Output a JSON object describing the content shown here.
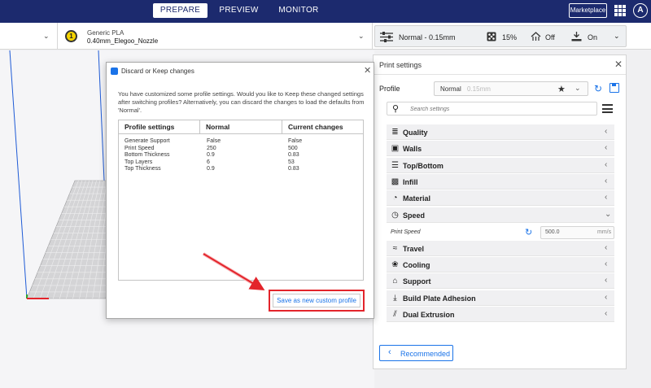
{
  "nav": {
    "tabs": [
      {
        "label": "PREPARE",
        "active": true
      },
      {
        "label": "PREVIEW",
        "active": false
      },
      {
        "label": "MONITOR",
        "active": false
      }
    ],
    "marketplace_label": "Marketplace",
    "avatar_initial": "A"
  },
  "toolbar": {
    "extruder_number": "1",
    "material": "Generic PLA",
    "nozzle": "0.40mm_Elegoo_Nozzle",
    "print_profile": "Normal - 0.15mm",
    "infill": "15%",
    "support": "Off",
    "adhesion": "On"
  },
  "panel": {
    "title": "Print settings",
    "profile_label": "Profile",
    "profile_name": "Normal",
    "profile_sub": "0.15mm",
    "search_placeholder": "Search settings",
    "categories": [
      {
        "label": "Quality",
        "icon": "quality-icon",
        "expanded": false
      },
      {
        "label": "Walls",
        "icon": "walls-icon",
        "expanded": false
      },
      {
        "label": "Top/Bottom",
        "icon": "top-bottom-icon",
        "expanded": false
      },
      {
        "label": "Infill",
        "icon": "infill-icon",
        "expanded": false
      },
      {
        "label": "Material",
        "icon": "material-icon",
        "expanded": false
      },
      {
        "label": "Speed",
        "icon": "speed-icon",
        "expanded": true
      },
      {
        "label": "Travel",
        "icon": "travel-icon",
        "expanded": false
      },
      {
        "label": "Cooling",
        "icon": "cooling-icon",
        "expanded": false
      },
      {
        "label": "Support",
        "icon": "support-icon",
        "expanded": false
      },
      {
        "label": "Build Plate Adhesion",
        "icon": "adhesion-icon",
        "expanded": false
      },
      {
        "label": "Dual Extrusion",
        "icon": "dual-extrusion-icon",
        "expanded": false
      }
    ],
    "print_speed": {
      "label": "Print Speed",
      "value": "500.0",
      "unit": "mm/s"
    },
    "recommended_label": "Recommended"
  },
  "dialog": {
    "title": "Discard or Keep changes",
    "message": "You have customized some profile settings. Would you like to Keep these changed settings after switching profiles? Alternatively, you can discard the changes to load the defaults from 'Normal'.",
    "columns": [
      "Profile settings",
      "Normal",
      "Current changes"
    ],
    "rows": [
      [
        "Generate Support",
        "False",
        "False"
      ],
      [
        "Print Speed",
        "250",
        "500"
      ],
      [
        "Bottom Thickness",
        "0.9",
        "0.83"
      ],
      [
        "Top Layers",
        "6",
        "53"
      ],
      [
        "Top Thickness",
        "0.9",
        "0.83"
      ]
    ],
    "button_label": "Save as new custom profile"
  },
  "colors": {
    "topbar": "#1c2a6e",
    "accent": "#1a73e8",
    "highlight": "#e3242b"
  }
}
